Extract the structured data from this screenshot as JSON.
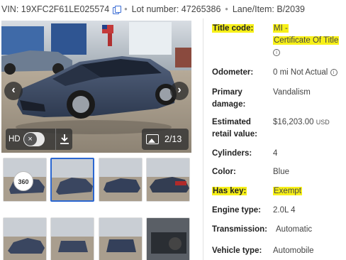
{
  "topbar": {
    "vin_label": "VIN:",
    "vin_value": "19XFC2F61LE025574",
    "lot_label": "Lot number:",
    "lot_value": "47265386",
    "lane_label": "Lane/Item:",
    "lane_value": "B/2039"
  },
  "gallery": {
    "hd_label": "HD",
    "counter": "2/13",
    "spin_badge": "360",
    "accent_color": "#2b67d1"
  },
  "details": {
    "title_code": {
      "label": "Title code:",
      "value_line1": "MI -",
      "value_line2": "Certificate Of Title"
    },
    "odometer": {
      "label": "Odometer:",
      "value": "0 mi Not Actual"
    },
    "primary_damage": {
      "label_line1": "Primary",
      "label_line2": "damage:",
      "value": "Vandalism"
    },
    "retail_value": {
      "label_line1": "Estimated",
      "label_line2": "retail value:",
      "value": "$16,203.00",
      "currency": "USD"
    },
    "cylinders": {
      "label": "Cylinders:",
      "value": "4"
    },
    "color": {
      "label": "Color:",
      "value": "Blue"
    },
    "has_key": {
      "label": "Has key:",
      "value": "Exempt"
    },
    "engine_type": {
      "label": "Engine type:",
      "value": "2.0L 4"
    },
    "transmission": {
      "label": "Transmission:",
      "value": "Automatic"
    },
    "vehicle_type": {
      "label": "Vehicle type:",
      "value": "Automobile"
    }
  },
  "highlight_color": "#f7f019"
}
